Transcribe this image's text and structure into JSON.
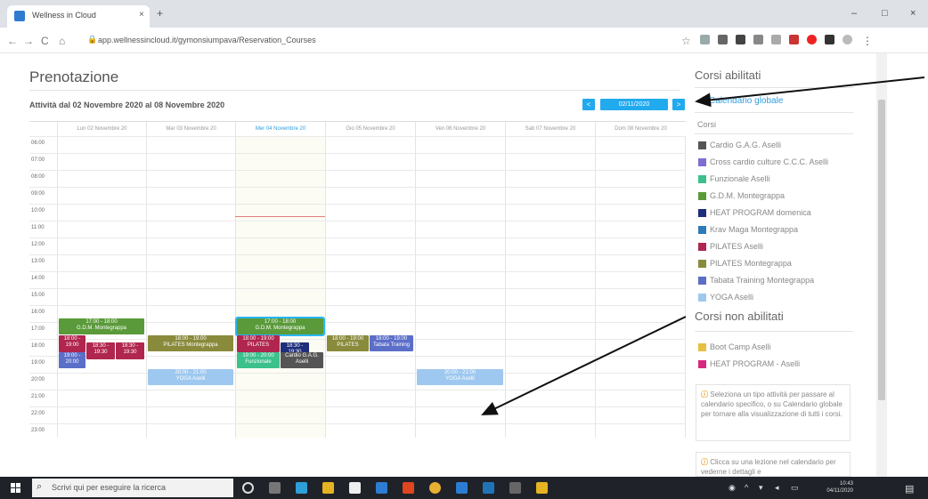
{
  "browser": {
    "tab_title": "Wellness in Cloud",
    "tab_close": "×",
    "new_tab": "+",
    "url": "app.wellnessincloud.it/gymonsiumpava/Reservation_Courses",
    "window_controls": [
      "–",
      "□",
      "×"
    ],
    "nav": [
      "←",
      "→",
      "C",
      "⌂"
    ]
  },
  "page": {
    "title": "Prenotazione",
    "period": "Attività dal 02 Novembre 2020 al 08 Novembre 2020",
    "prev_label": "<",
    "date_label": "02/11/2020",
    "next_label": ">"
  },
  "calendar": {
    "days": [
      "Lun 02 Novembre 20",
      "Mar 03 Novembre 20",
      "Mer 04 Novembre 20",
      "Gio 05 Novembre 20",
      "Ven 06 Novembre 20",
      "Sab 07 Novembre 20",
      "Dom 08 Novembre 20"
    ],
    "hours": [
      "06:00",
      "07:00",
      "08:00",
      "09:00",
      "10:00",
      "11:00",
      "12:00",
      "13:00",
      "14:00",
      "15:00",
      "16:00",
      "17:00",
      "18:00",
      "19:00",
      "20:00",
      "21:00",
      "22:00",
      "23:00"
    ],
    "events": [
      {
        "time": "17:00 - 18:00",
        "name": "G.D.M. Montegrappa",
        "color": "#5a9a3a"
      },
      {
        "time": "18:00 - 19:00",
        "name": "",
        "color": "#b0264e"
      },
      {
        "time": "18:30 - 19:30",
        "name": "",
        "color": "#b0264e"
      },
      {
        "time": "18:30 - 19:30",
        "name": "",
        "color": "#b0264e"
      },
      {
        "time": "19:00 - 20:00",
        "name": "",
        "color": "#5b6ec8"
      },
      {
        "time": "18:00 - 19:00",
        "name": "PILATES Montegrappa",
        "color": "#8a8a3c"
      },
      {
        "time": "17:00 - 18:00",
        "name": "G.D.M. Montegrappa",
        "color": "#5a9a3a"
      },
      {
        "time": "18:00 - 19:00",
        "name": "PILATES",
        "color": "#b0264e"
      },
      {
        "time": "18:30 - 19:30",
        "name": "",
        "color": "#1f2e7a"
      },
      {
        "time": "19:00 - 20:00",
        "name": "Funzionale",
        "color": "#3cc08c"
      },
      {
        "time": "",
        "name": "Cardio G.A.G. Aselli",
        "color": "#555555"
      },
      {
        "time": "18:00 - 19:00",
        "name": "PILATES",
        "color": "#8a8a3c"
      },
      {
        "time": "18:00 - 19:00",
        "name": "Tabata Training",
        "color": "#5b6ec8"
      },
      {
        "time": "20:00 - 21:00",
        "name": "YOGA Aselli",
        "color": "#9ec8ef"
      },
      {
        "time": "20:00 - 21:00",
        "name": "YOGA Aselli",
        "color": "#9ec8ef"
      },
      {
        "time": "20:00 - 21:00",
        "name": "YOGA Aselli",
        "color": "#9ec8ef"
      }
    ]
  },
  "sidebar": {
    "title": "Corsi abilitati",
    "global_link": "Calendario globale",
    "courses_label": "Corsi",
    "enabled": [
      {
        "label": "Cardio G.A.G. Aselli",
        "color": "#555555"
      },
      {
        "label": "Cross cardio culture C.C.C. Aselli",
        "color": "#7d6fd0"
      },
      {
        "label": "Funzionale Aselli",
        "color": "#3cc08c"
      },
      {
        "label": "G.D.M. Montegrappa",
        "color": "#5a9a3a"
      },
      {
        "label": "HEAT PROGRAM domenica",
        "color": "#1f2e7a"
      },
      {
        "label": "Krav Maga Montegrappa",
        "color": "#2f7bb8"
      },
      {
        "label": "PILATES Aselli",
        "color": "#b0264e"
      },
      {
        "label": "PILATES Montegrappa",
        "color": "#8a8a3c"
      },
      {
        "label": "Tabata Training Montegrappa",
        "color": "#5b6ec8"
      },
      {
        "label": "YOGA Aselli",
        "color": "#9ec8ef"
      }
    ],
    "disabled_title": "Corsi non abilitati",
    "disabled": [
      {
        "label": "Boot Camp Aselli",
        "color": "#e8c040"
      },
      {
        "label": "HEAT PROGRAM - Aselli",
        "color": "#d8287e"
      }
    ],
    "hint1": "Seleziona un tipo attività per passare al calendario specifico, o su Calendario globale per tornare alla visualizzazione di tutti i corsi.",
    "hint2": "Clicca su una lezione nel calendario per vederne i dettagli e"
  },
  "taskbar": {
    "search_placeholder": "Scrivi qui per eseguire la ricerca",
    "time": "10:43",
    "date": "04/11/2020"
  }
}
